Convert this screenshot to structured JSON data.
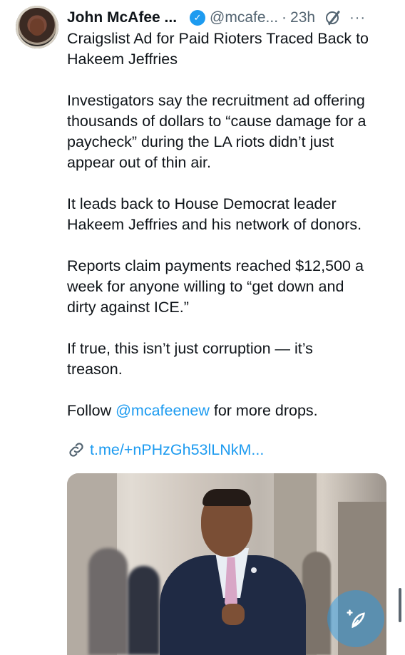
{
  "tweet": {
    "author_name": "John McAfee ...",
    "handle": "@mcafe...",
    "separator": "·",
    "time": "23h",
    "more": "···",
    "paragraphs": [
      "Craigslist Ad for Paid Rioters Traced Back to\nHakeem Jeffries",
      "Investigators say the recruitment ad offering\nthousands of dollars to “cause damage for a\npaycheck” during the LA riots didn’t just\nappear out of thin air.",
      "It leads back to House Democrat leader\nHakeem Jeffries and his network of donors.",
      "Reports claim payments reached $12,500 a\nweek for anyone willing to “get down and\ndirty against ICE.”",
      "If true, this isn’t just corruption — it’s\ntreason."
    ],
    "follow_prefix": "Follow ",
    "follow_mention": "@mcafeenew",
    "follow_suffix": " for more drops.",
    "link_text": "t.me/+nPHzGh53lLNkM..."
  },
  "icons": {
    "verified": "verified-badge-icon",
    "grok": "grok-icon",
    "more": "more-icon",
    "link": "link-icon",
    "compose": "compose-icon"
  },
  "colors": {
    "accent": "#1d9bf0",
    "secondary_text": "#536471",
    "primary_text": "#0f1419"
  }
}
